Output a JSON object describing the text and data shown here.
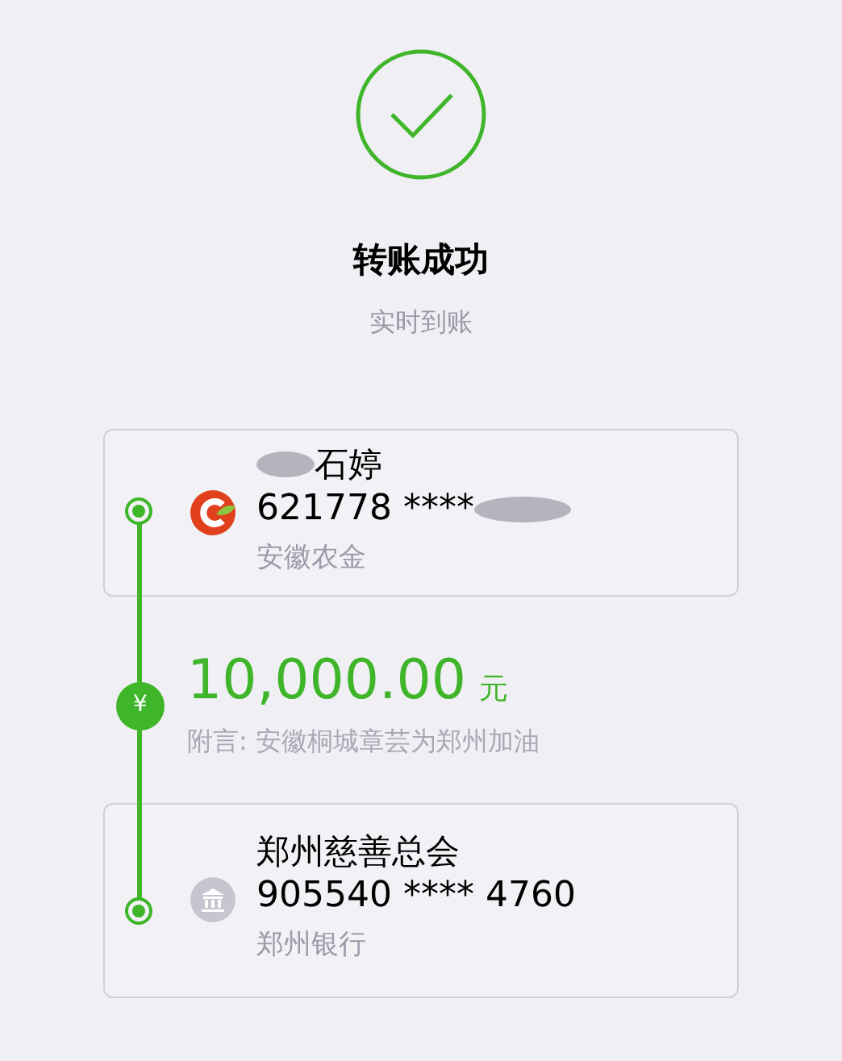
{
  "result": {
    "title": "转账成功",
    "subtitle": "实时到账"
  },
  "payer": {
    "name": "石婷",
    "account": "621778 ****",
    "bank": "安徽农金",
    "redacted": true
  },
  "transfer": {
    "amount": "10,000.00",
    "currency": "元",
    "badge": "¥",
    "note": "附言: 安徽桐城章芸为郑州加油"
  },
  "payee": {
    "name": "郑州慈善总会",
    "account": "905540 **** 4760",
    "bank": "郑州银行",
    "redacted": false
  }
}
